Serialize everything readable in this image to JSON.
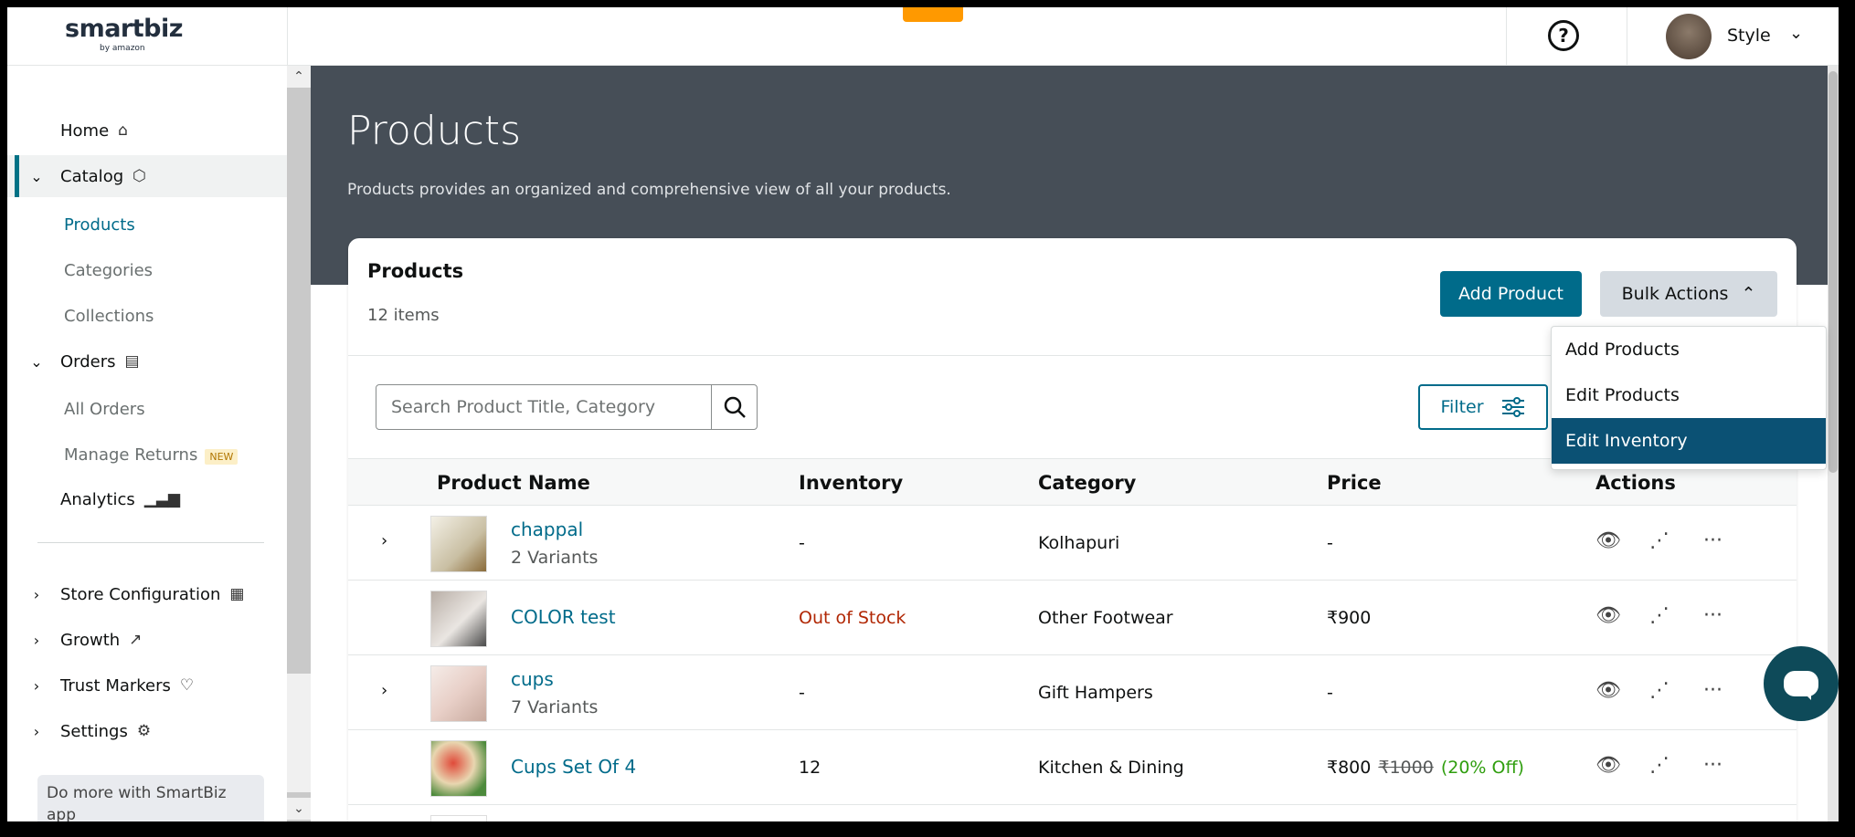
{
  "brand": {
    "logo_main": "smartbiz",
    "logo_sub": "by amazon"
  },
  "header": {
    "user_name": "Style"
  },
  "sidebar": {
    "home": "Home",
    "catalog": "Catalog",
    "products": "Products",
    "categories": "Categories",
    "collections": "Collections",
    "orders": "Orders",
    "all_orders": "All Orders",
    "manage_returns": "Manage Returns",
    "new_badge": "NEW",
    "analytics": "Analytics",
    "store_configuration": "Store Configuration",
    "growth": "Growth",
    "trust_markers": "Trust Markers",
    "settings": "Settings",
    "promo": "Do more with SmartBiz app"
  },
  "hero": {
    "title": "Products",
    "subtitle": "Products provides an organized and comprehensive view of all your products."
  },
  "card": {
    "title": "Products",
    "count": "12 items",
    "add_product": "Add Product",
    "bulk_actions": "Bulk Actions",
    "search_placeholder": "Search Product Title, Category",
    "filter": "Filter"
  },
  "bulk_menu": [
    "Add Products",
    "Edit Products",
    "Edit Inventory"
  ],
  "table": {
    "headers": [
      "Product Name",
      "Inventory",
      "Category",
      "Price",
      "Actions"
    ],
    "rows": [
      {
        "name": "chappal",
        "variants": "2 Variants",
        "inventory": "-",
        "category": "Kolhapuri",
        "price": "-"
      },
      {
        "name": "COLOR test",
        "variants": "",
        "inventory": "Out of Stock",
        "category": "Other Footwear",
        "price": "₹900"
      },
      {
        "name": "cups",
        "variants": "7 Variants",
        "inventory": "-",
        "category": "Gift Hampers",
        "price": "-"
      },
      {
        "name": "Cups Set Of 4",
        "variants": "",
        "inventory": "12",
        "category": "Kitchen & Dining",
        "price": "₹800",
        "original_price": "₹1000",
        "discount": "(20% Off)"
      }
    ]
  },
  "colors": {
    "accent": "#006b8a",
    "hero_bg": "#464e57",
    "out_of_stock": "#b12704",
    "discount": "#2f9e0e",
    "selected_menu": "#0b5174"
  }
}
